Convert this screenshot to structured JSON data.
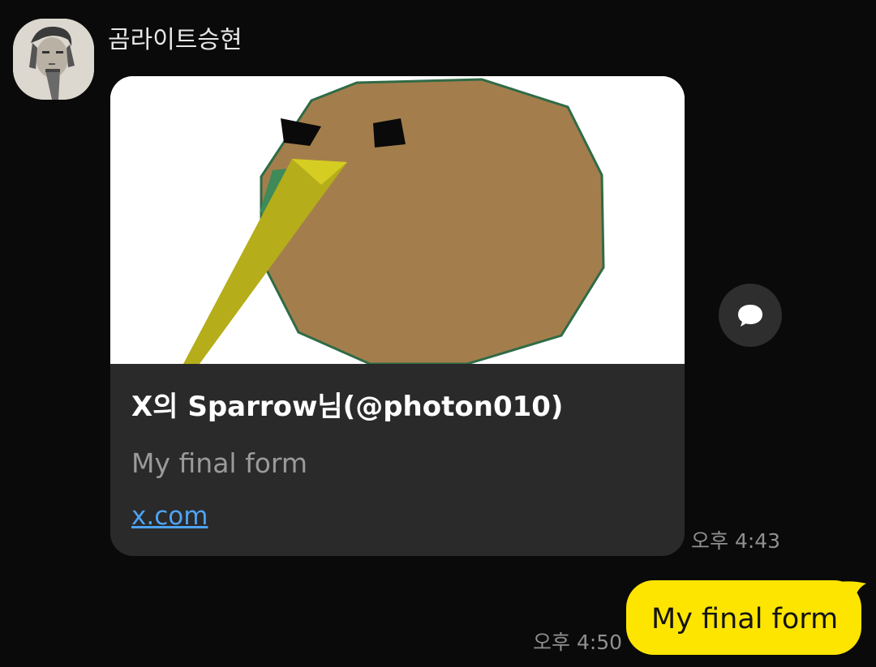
{
  "received_message": {
    "sender_name": "곰라이트승현",
    "avatar_icon": "profile-photo-icon",
    "link_preview": {
      "image_icon": "kiwi-bird-illustration-icon",
      "title": "X의 Sparrow님(@photon010)",
      "description": "My final form",
      "url_text": "x.com"
    },
    "share_icon": "chat-bubble-icon",
    "time": "오후 4:43"
  },
  "sent_message": {
    "text": "My final form",
    "time": "오후 4:50",
    "bubble_color": "#fee500"
  },
  "colors": {
    "background": "#0a0a0a",
    "card_background": "#2a2a2a",
    "link_color": "#4da3f5"
  }
}
